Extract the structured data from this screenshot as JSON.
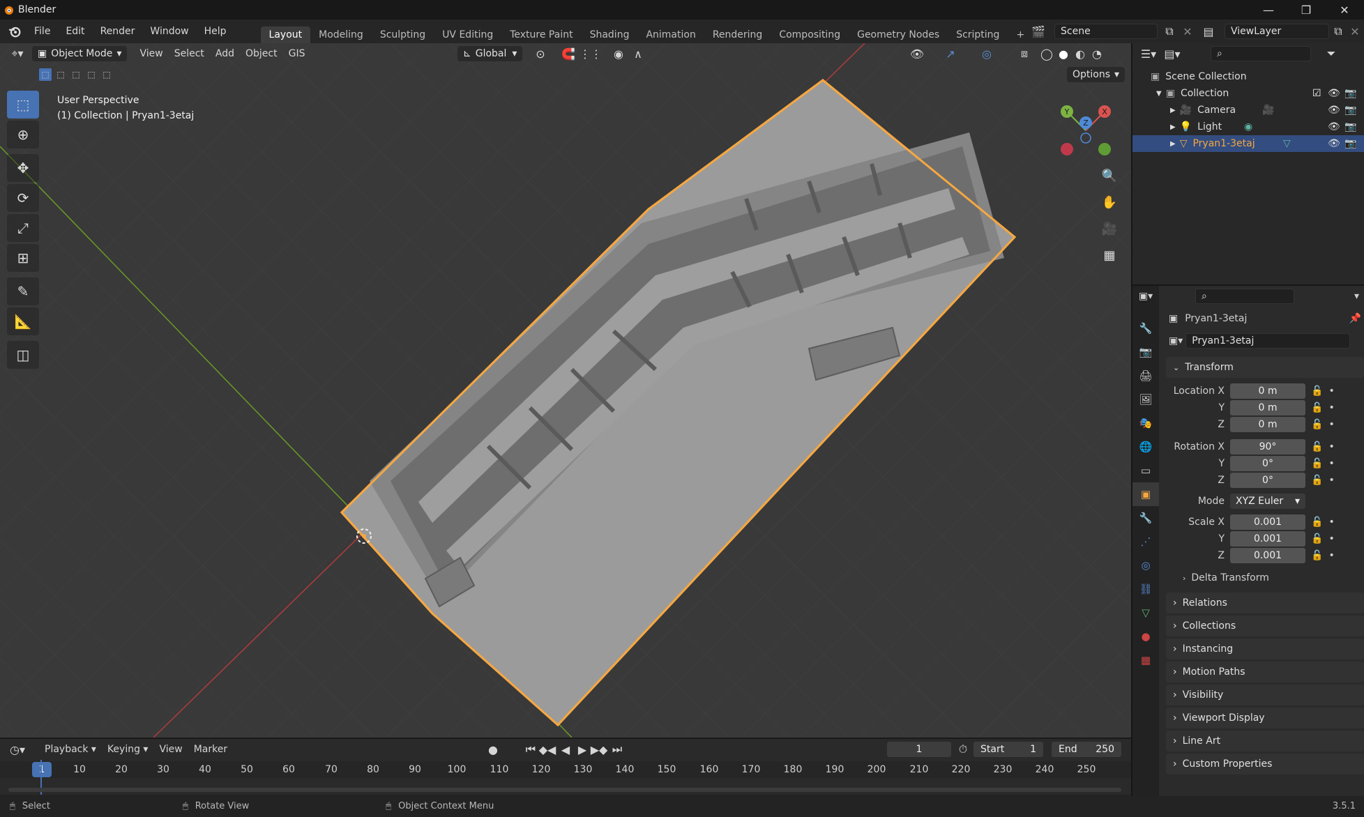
{
  "window": {
    "title": "Blender",
    "version": "3.5.1"
  },
  "menu": [
    "File",
    "Edit",
    "Render",
    "Window",
    "Help"
  ],
  "workspaces": [
    "Layout",
    "Modeling",
    "Sculpting",
    "UV Editing",
    "Texture Paint",
    "Shading",
    "Animation",
    "Rendering",
    "Compositing",
    "Geometry Nodes",
    "Scripting"
  ],
  "active_workspace": "Layout",
  "scene": {
    "name": "Scene",
    "view_layer": "ViewLayer"
  },
  "viewport": {
    "mode": "Object Mode",
    "menus": [
      "View",
      "Select",
      "Add",
      "Object",
      "GIS"
    ],
    "orientation": "Global",
    "options_label": "Options",
    "info_line1": "User Perspective",
    "info_line2": "(1) Collection | Pryan1-3etaj",
    "gizmo": {
      "x": "X",
      "y": "Y",
      "z": "Z"
    }
  },
  "tools": [
    "select-box",
    "cursor",
    "move",
    "rotate",
    "scale",
    "transform",
    "annotate",
    "measure",
    "add-cube"
  ],
  "outliner": {
    "root": "Scene Collection",
    "collection": "Collection",
    "items": [
      {
        "name": "Camera",
        "selected": false
      },
      {
        "name": "Light",
        "selected": false
      },
      {
        "name": "Pryan1-3etaj",
        "selected": true
      }
    ]
  },
  "properties": {
    "object_name": "Pryan1-3etaj",
    "data_name": "Pryan1-3etaj",
    "transform_label": "Transform",
    "location": {
      "label": "Location X",
      "x": "0 m",
      "y": "0 m",
      "z": "0 m"
    },
    "rotation": {
      "label": "Rotation X",
      "x": "90°",
      "y": "0°",
      "z": "0°"
    },
    "mode_label": "Mode",
    "mode_value": "XYZ Euler",
    "scale": {
      "label": "Scale X",
      "x": "0.001",
      "y": "0.001",
      "z": "0.001"
    },
    "axis_y": "Y",
    "axis_z": "Z",
    "delta_transform": "Delta Transform",
    "panels": [
      "Relations",
      "Collections",
      "Instancing",
      "Motion Paths",
      "Visibility",
      "Viewport Display",
      "Line Art",
      "Custom Properties"
    ]
  },
  "timeline": {
    "menus": [
      "Playback",
      "Keying",
      "View",
      "Marker"
    ],
    "current_frame": "1",
    "start_label": "Start",
    "start": "1",
    "end_label": "End",
    "end": "250",
    "ticks": [
      "1",
      "10",
      "20",
      "30",
      "40",
      "50",
      "60",
      "70",
      "80",
      "90",
      "100",
      "110",
      "120",
      "130",
      "140",
      "150",
      "160",
      "170",
      "180",
      "190",
      "200",
      "210",
      "220",
      "230",
      "240",
      "250"
    ]
  },
  "status": {
    "select": "Select",
    "rotate": "Rotate View",
    "context": "Object Context Menu"
  },
  "colors": {
    "accent": "#4772b3",
    "selection": "#f5a742",
    "grid_x": "#b03c3c",
    "grid_y": "#6a9a26"
  }
}
